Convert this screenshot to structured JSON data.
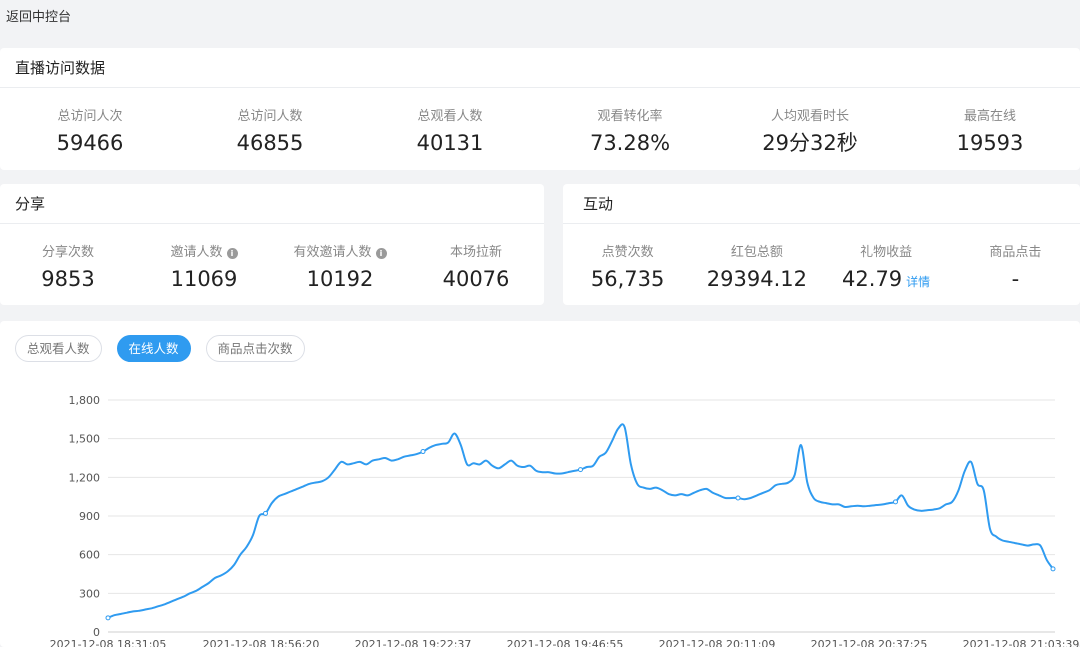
{
  "back_label": "返回中控台",
  "visits": {
    "title": "直播访问数据",
    "items": [
      {
        "label": "总访问人次",
        "value": "59466"
      },
      {
        "label": "总访问人数",
        "value": "46855"
      },
      {
        "label": "总观看人数",
        "value": "40131"
      },
      {
        "label": "观看转化率",
        "value": "73.28%"
      },
      {
        "label": "人均观看时长",
        "value": "29分32秒"
      },
      {
        "label": "最高在线",
        "value": "19593"
      }
    ]
  },
  "share": {
    "title": "分享",
    "items": [
      {
        "label": "分享次数",
        "value": "9853"
      },
      {
        "label": "邀请人数",
        "value": "11069"
      },
      {
        "label": "有效邀请人数",
        "value": "10192"
      },
      {
        "label": "本场拉新",
        "value": "40076"
      }
    ]
  },
  "interact": {
    "title": "互动",
    "items": [
      {
        "label": "点赞次数",
        "value": "56,735"
      },
      {
        "label": "红包总额",
        "value": "29394.12"
      },
      {
        "label": "礼物收益",
        "value": "42.79"
      },
      {
        "label": "商品点击",
        "value": "-"
      }
    ],
    "detail_label": "详情"
  },
  "tabs": [
    {
      "label": "总观看人数",
      "active": false
    },
    {
      "label": "在线人数",
      "active": true
    },
    {
      "label": "商品点击次数",
      "active": false
    }
  ],
  "colors": {
    "accent": "#2f9bf0",
    "line": "#2f9bf0",
    "grid": "#e6e6e6"
  },
  "chart_data": {
    "type": "line",
    "ylim": [
      0,
      1800
    ],
    "yticks": [
      "0",
      "300",
      "600",
      "900",
      "1,200",
      "1,500",
      "1,800"
    ],
    "xticks": [
      "2021-12-08 18:31:05",
      "2021-12-08 18:56:20",
      "2021-12-08 19:22:37",
      "2021-12-08 19:46:55",
      "2021-12-08 20:11:09",
      "2021-12-08 20:37:25",
      "2021-12-08 21:03:39"
    ],
    "series": [
      {
        "values": [
          110,
          130,
          140,
          150,
          160,
          165,
          175,
          185,
          200,
          215,
          235,
          255,
          275,
          300,
          320,
          350,
          380,
          420,
          440,
          470,
          520,
          600,
          660,
          750,
          900,
          920,
          1000,
          1050,
          1070,
          1090,
          1110,
          1130,
          1150,
          1160,
          1170,
          1200,
          1260,
          1320,
          1300,
          1310,
          1320,
          1300,
          1330,
          1340,
          1350,
          1330,
          1340,
          1360,
          1370,
          1380,
          1400,
          1430,
          1450,
          1460,
          1470,
          1540,
          1450,
          1300,
          1310,
          1300,
          1330,
          1290,
          1270,
          1300,
          1330,
          1290,
          1280,
          1290,
          1250,
          1240,
          1240,
          1230,
          1230,
          1240,
          1250,
          1260,
          1280,
          1290,
          1360,
          1390,
          1480,
          1580,
          1590,
          1300,
          1150,
          1120,
          1110,
          1120,
          1100,
          1070,
          1060,
          1070,
          1060,
          1080,
          1100,
          1110,
          1080,
          1060,
          1040,
          1040,
          1040,
          1030,
          1040,
          1060,
          1080,
          1100,
          1140,
          1150,
          1160,
          1220,
          1450,
          1160,
          1040,
          1010,
          1000,
          990,
          990,
          970,
          975,
          980,
          975,
          980,
          985,
          990,
          1000,
          1010,
          1060,
          980,
          950,
          940,
          945,
          950,
          960,
          990,
          1010,
          1100,
          1250,
          1320,
          1150,
          1100,
          800,
          740,
          710,
          700,
          690,
          680,
          670,
          680,
          670,
          560,
          490
        ]
      }
    ]
  }
}
